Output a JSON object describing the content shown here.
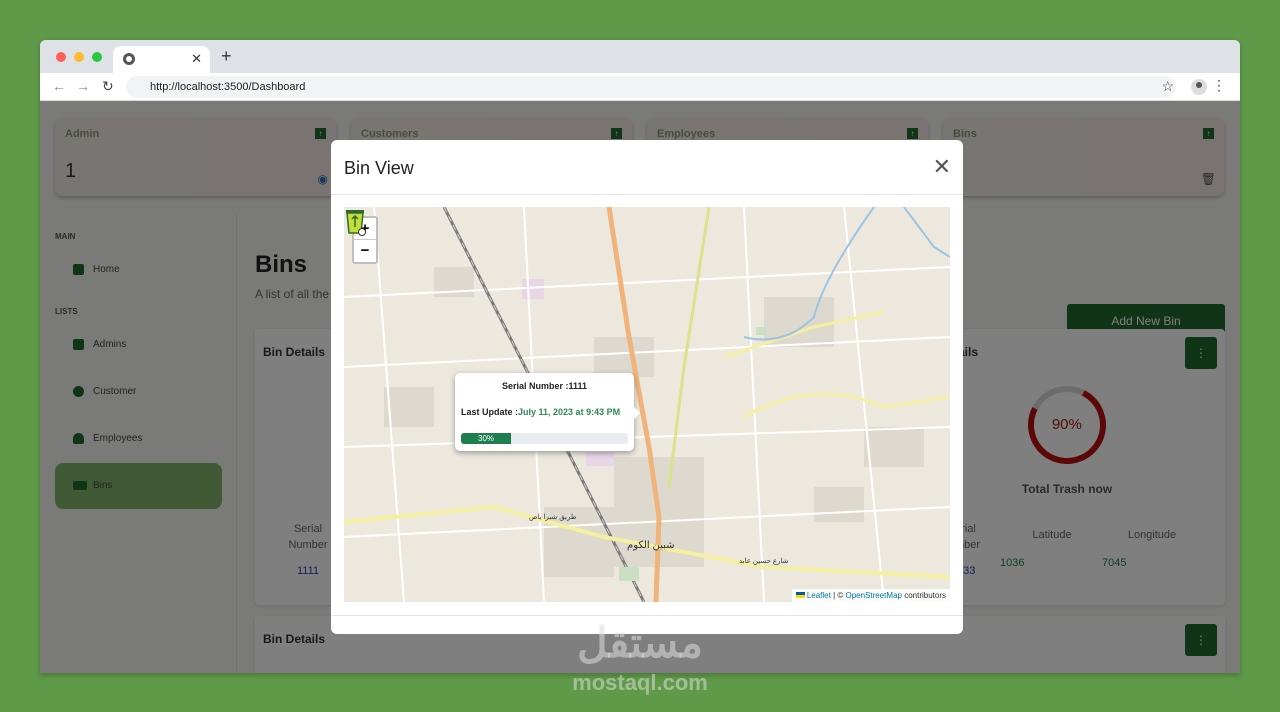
{
  "browser": {
    "url": "http://localhost:3500/Dashboard",
    "window_dots": [
      "#ff5f57",
      "#febc2e",
      "#28c840"
    ],
    "tab_close": "✕",
    "new_tab": "+"
  },
  "stats": [
    {
      "label": "Admin",
      "value": "1"
    },
    {
      "label": "Customers",
      "value": ""
    },
    {
      "label": "Employees",
      "value": ""
    },
    {
      "label": "Bins",
      "value": ""
    }
  ],
  "sidebar": {
    "sections": {
      "main": "MAIN",
      "lists": "LISTS"
    },
    "items": [
      {
        "label": "Home",
        "icon": "dashboard-icon"
      },
      {
        "label": "Admins",
        "icon": "admin-icon"
      },
      {
        "label": "Customer",
        "icon": "user-icon"
      },
      {
        "label": "Employees",
        "icon": "employee-icon"
      },
      {
        "label": "Bins",
        "icon": "truck-icon"
      }
    ]
  },
  "main": {
    "title": "Bins",
    "subtitle": "A list of all the",
    "add_button": "Add New Bin",
    "panel1": {
      "title": "Bin Details",
      "serial_header": "Serial Number",
      "serial_value": "1111"
    },
    "panel2": {
      "title_fragment": "ails",
      "percent": "90%",
      "percent_value": 90,
      "caption": "Total Trash now",
      "serial_header_fragment": "erial\nmber",
      "serial_value_fragment": "333",
      "lat_header": "Latitude",
      "lat_value": "1036",
      "lon_header": "Longitude",
      "lon_value": "7045"
    },
    "panel3": {
      "title": "Bin Details"
    }
  },
  "modal": {
    "title": "Bin View",
    "close": "✕",
    "zoom_in": "+",
    "zoom_out": "−",
    "popup": {
      "serial_label": "Serial Number :1111",
      "update_prefix": "Last Update :",
      "update_date": "July 11, 2023 at 9:43 PM",
      "fill_label": "30%",
      "fill_value": 30
    },
    "map_labels": {
      "town": "شبين الكوم",
      "road1": "طريق شبرا باص",
      "road2": "شارع حسين عابد"
    },
    "attribution": {
      "leaflet": "Leaflet",
      "sep": " | © ",
      "osm": "OpenStreetMap",
      "suffix": " contributors"
    }
  },
  "watermark": {
    "arabic": "مستقل",
    "latin": "mostaql.com"
  },
  "colors": {
    "accent": "#1f6b2c",
    "background": "#5f9a48",
    "ring": "#bb1111"
  }
}
